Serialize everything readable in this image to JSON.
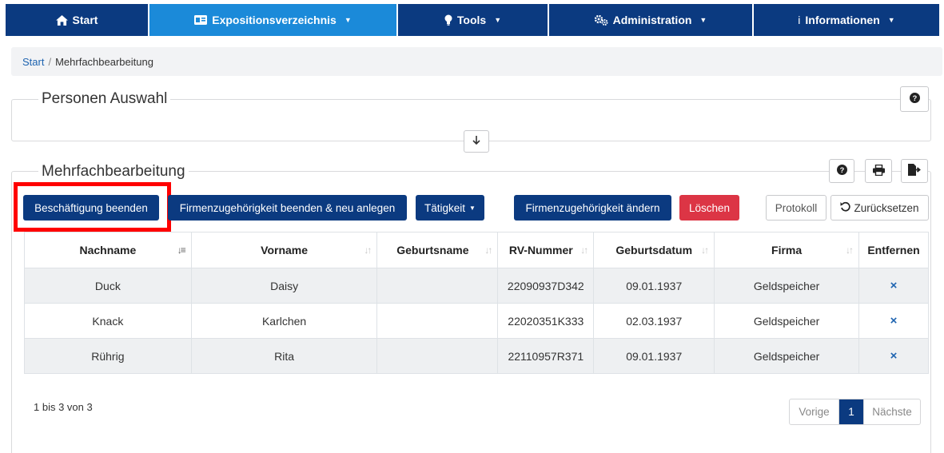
{
  "nav": {
    "start": "Start",
    "exposition": "Expositionsverzeichnis",
    "tools": "Tools",
    "administration": "Administration",
    "informationen": "Informationen",
    "info_prefix": "i"
  },
  "breadcrumb": {
    "home": "Start",
    "separator": "/",
    "current": "Mehrfachbearbeitung"
  },
  "section1": {
    "title": "Personen Auswahl"
  },
  "section2": {
    "title": "Mehrfachbearbeitung"
  },
  "actions": {
    "end_employment": "Beschäftigung beenden",
    "end_and_new": "Firmenzugehörigkeit beenden & neu anlegen",
    "activity": "Tätigkeit",
    "change_company": "Firmenzugehörigkeit ändern",
    "delete": "Löschen",
    "protocol": "Protokoll",
    "reset": "Zurücksetzen"
  },
  "table": {
    "headers": [
      "Nachname",
      "Vorname",
      "Geburtsname",
      "RV-Nummer",
      "Geburtsdatum",
      "Firma",
      "Entfernen"
    ],
    "rows": [
      {
        "nachname": "Duck",
        "vorname": "Daisy",
        "geburtsname": "",
        "rv": "22090937D342",
        "geburtsdatum": "09.01.1937",
        "firma": "Geldspeicher"
      },
      {
        "nachname": "Knack",
        "vorname": "Karlchen",
        "geburtsname": "",
        "rv": "22020351K333",
        "geburtsdatum": "02.03.1937",
        "firma": "Geldspeicher"
      },
      {
        "nachname": "Rührig",
        "vorname": "Rita",
        "geburtsname": "",
        "rv": "22110957R371",
        "geburtsdatum": "09.01.1937",
        "firma": "Geldspeicher"
      }
    ],
    "remove_symbol": "×"
  },
  "footer": {
    "info": "1 bis 3 von 3",
    "prev": "Vorige",
    "page": "1",
    "next": "Nächste"
  },
  "colors": {
    "nav_bg": "#0b3a80",
    "nav_active": "#1b8ad9",
    "danger": "#dc3545",
    "highlight": "#ff0000"
  }
}
